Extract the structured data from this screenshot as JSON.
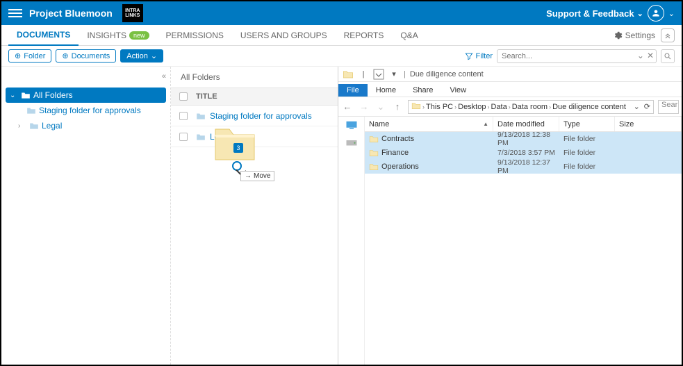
{
  "topbar": {
    "project_title": "Project Bluemoon",
    "brand": "INTRA\nLINKS",
    "support_label": "Support & Feedback"
  },
  "tabs": {
    "items": [
      {
        "label": "DOCUMENTS"
      },
      {
        "label": "INSIGHTS",
        "badge": "new"
      },
      {
        "label": "PERMISSIONS"
      },
      {
        "label": "USERS AND GROUPS"
      },
      {
        "label": "REPORTS"
      },
      {
        "label": "Q&A"
      }
    ],
    "settings_label": "Settings"
  },
  "actionbar": {
    "folder_btn": "Folder",
    "documents_btn": "Documents",
    "action_btn": "Action",
    "filter_label": "Filter",
    "search_placeholder": "Search..."
  },
  "sidebar": {
    "root_label": "All Folders",
    "children": [
      {
        "label": "Staging folder for approvals"
      },
      {
        "label": "Legal"
      }
    ]
  },
  "listing": {
    "breadcrumb": "All Folders",
    "title_col": "TITLE",
    "rows": [
      {
        "name": "Staging folder for approvals"
      },
      {
        "name": "Legal"
      }
    ],
    "drag_count": "3",
    "drag_tooltip": "Move"
  },
  "explorer": {
    "window_title": "Due diligence content",
    "ribbon": {
      "file": "File",
      "home": "Home",
      "share": "Share",
      "view": "View"
    },
    "breadcrumb": [
      "This PC",
      "Desktop",
      "Data",
      "Data room",
      "Due diligence content"
    ],
    "search_placeholder": "Sear",
    "columns": {
      "name": "Name",
      "date": "Date modified",
      "type": "Type",
      "size": "Size"
    },
    "rows": [
      {
        "name": "Contracts",
        "date": "9/13/2018 12:38 PM",
        "type": "File folder"
      },
      {
        "name": "Finance",
        "date": "7/3/2018 3:57 PM",
        "type": "File folder"
      },
      {
        "name": "Operations",
        "date": "9/13/2018 12:37 PM",
        "type": "File folder"
      }
    ]
  }
}
